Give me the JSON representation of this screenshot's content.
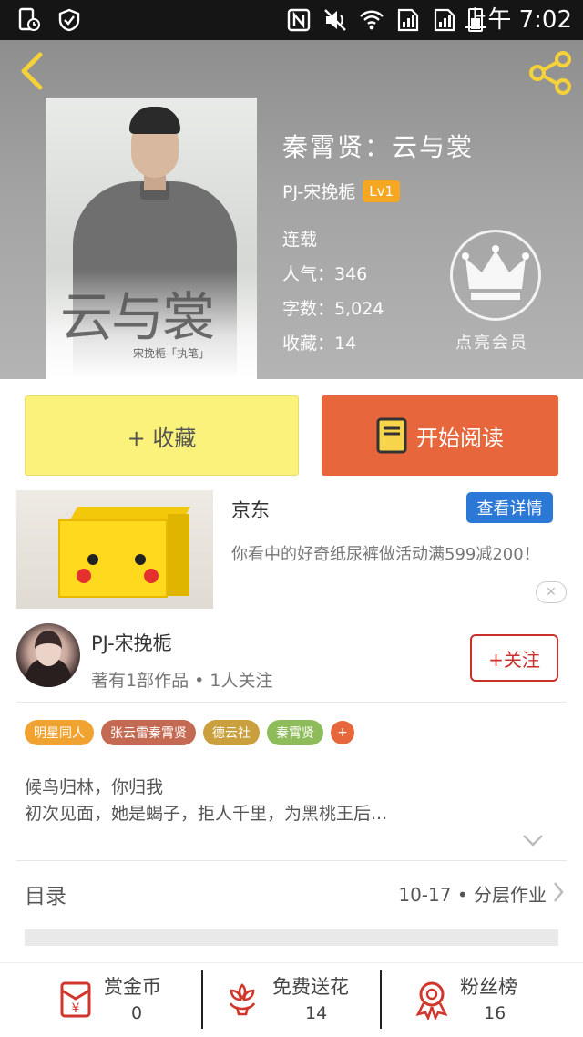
{
  "status_bar": {
    "time": "上午 7:02"
  },
  "book": {
    "title": "秦霄贤：云与裳",
    "author": "PJ-宋挽栀",
    "level": "Lv1",
    "status": "连载",
    "popularity": "人气：346",
    "word_count": "字数：5,024",
    "favorites": "收藏：14",
    "cover_text": "云与裳",
    "cover_subtitle": "宋挽栀「执笔」"
  },
  "vip": {
    "label": "点亮会员"
  },
  "actions": {
    "favorite_label": "+ 收藏",
    "read_label": "开始阅读"
  },
  "ad": {
    "brand": "京东",
    "detail_label": "查看详情",
    "description": "你看中的好奇纸尿裤做活动满599减200！",
    "close_label": "✕"
  },
  "author_card": {
    "name": "PJ-宋挽栀",
    "works": "著有1部作品 • 1人关注",
    "follow_label": "+关注"
  },
  "tags": [
    {
      "label": "明星同人",
      "color": "#f0a331"
    },
    {
      "label": "张云雷秦霄贤",
      "color": "#c46a52"
    },
    {
      "label": "德云社",
      "color": "#c9a03d"
    },
    {
      "label": "秦霄贤",
      "color": "#8fbc5a"
    }
  ],
  "tag_more": "+",
  "synopsis": {
    "line1": "候鸟归林，你归我",
    "line2": "初次见面，她是蝎子，拒人千里，为黑桃王后..."
  },
  "toc": {
    "label": "目录",
    "latest": "10-17 • 分层作业"
  },
  "bottom_bar": [
    {
      "icon": "red-envelope-icon",
      "label": "赏金币",
      "count": "0"
    },
    {
      "icon": "flower-icon",
      "label": "免费送花",
      "count": "14"
    },
    {
      "icon": "medal-icon",
      "label": "粉丝榜",
      "count": "16"
    }
  ],
  "colors": {
    "accent_orange": "#e8663b",
    "favorite_yellow": "#fbf27c",
    "level_badge": "#f5a623",
    "ad_button_blue": "#2b78d6",
    "follow_red": "#c9302c",
    "icon_red": "#d0362c"
  }
}
